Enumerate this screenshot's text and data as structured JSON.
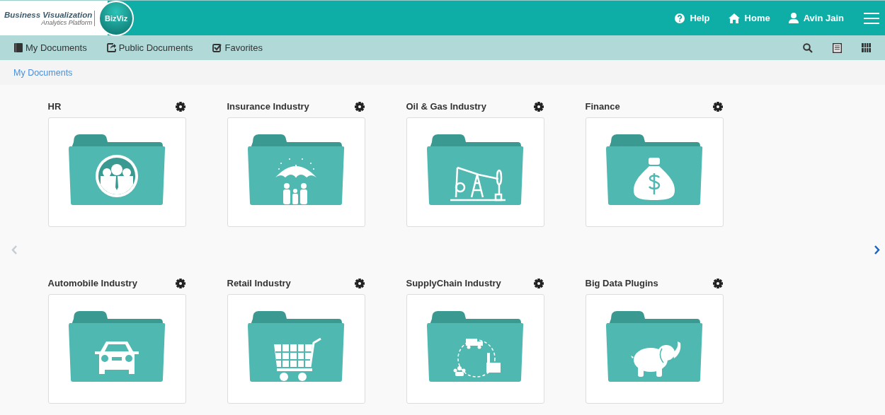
{
  "header": {
    "logo_title": "Business Visualization",
    "logo_subtitle": "Analytics Platform",
    "logo_badge": "BizViz",
    "links": [
      {
        "kind": "help",
        "label": "Help"
      },
      {
        "kind": "home",
        "label": "Home"
      },
      {
        "kind": "user",
        "label": "Avin Jain"
      }
    ]
  },
  "toolbar": {
    "tabs": [
      {
        "kind": "book",
        "label": "My Documents"
      },
      {
        "kind": "share",
        "label": "Public Documents"
      },
      {
        "kind": "check",
        "label": "Favorites"
      }
    ],
    "tools": [
      {
        "kind": "search"
      },
      {
        "kind": "list"
      },
      {
        "kind": "grid"
      }
    ]
  },
  "breadcrumb": "My Documents",
  "folders": [
    {
      "name": "HR",
      "kind": "people"
    },
    {
      "name": "Insurance Industry",
      "kind": "umbrella"
    },
    {
      "name": "Oil & Gas Industry",
      "kind": "pumpjack"
    },
    {
      "name": "Finance",
      "kind": "moneybag"
    },
    {
      "name": "Automobile Industry",
      "kind": "car"
    },
    {
      "name": "Retail Industry",
      "kind": "cart"
    },
    {
      "name": "SupplyChain Industry",
      "kind": "supplychain"
    },
    {
      "name": "Big Data Plugins",
      "kind": "elephant"
    }
  ]
}
